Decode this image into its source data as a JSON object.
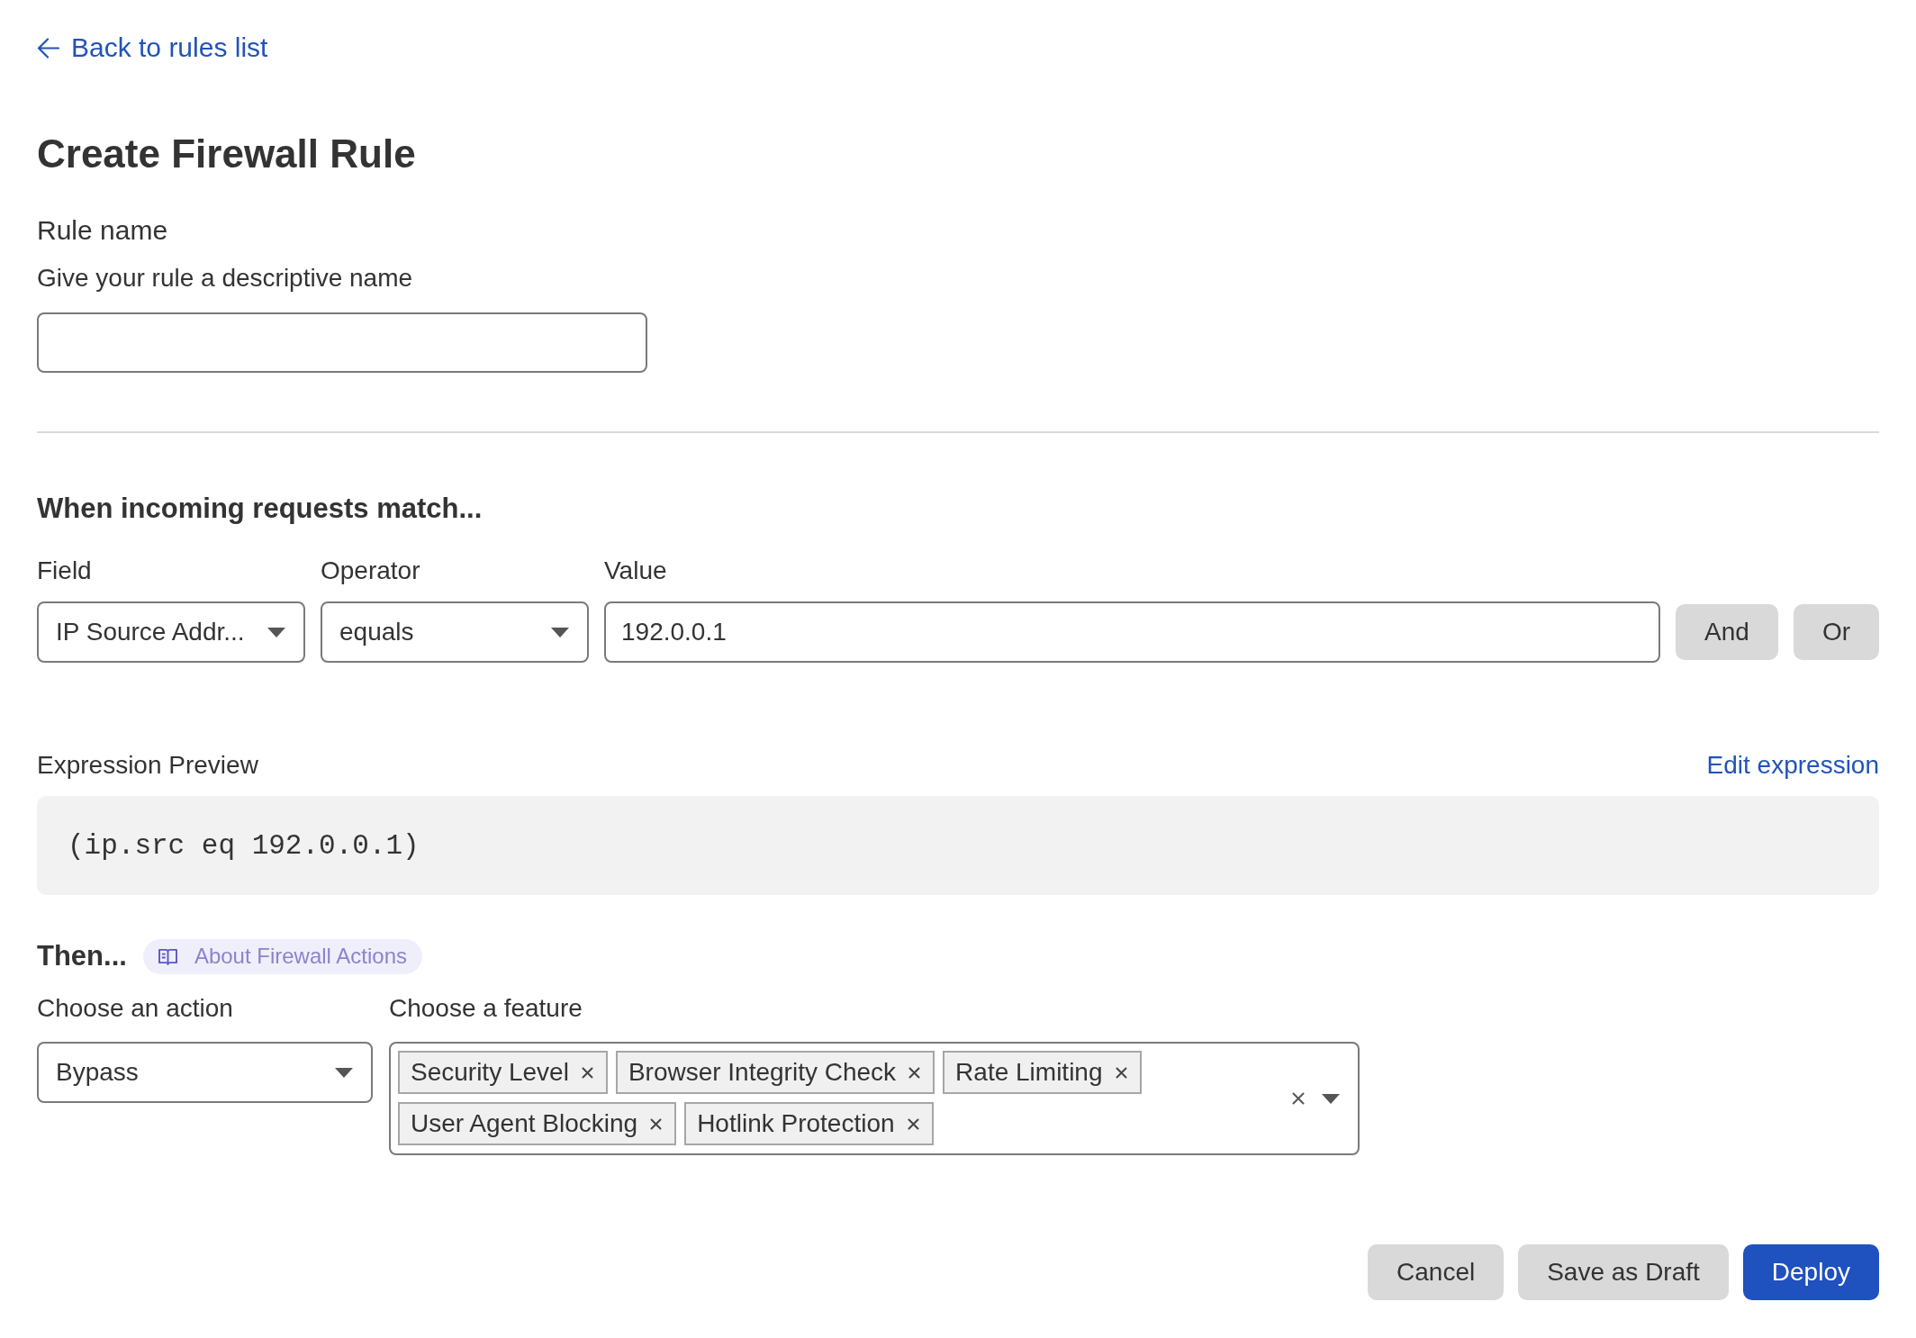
{
  "back_link": "Back to rules list",
  "title": "Create Firewall Rule",
  "rule_name": {
    "label": "Rule name",
    "hint": "Give your rule a descriptive name"
  },
  "match": {
    "heading": "When incoming requests match...",
    "field": {
      "label": "Field",
      "value": "IP Source Addr..."
    },
    "operator": {
      "label": "Operator",
      "value": "equals"
    },
    "value": {
      "label": "Value",
      "value": "192.0.0.1"
    },
    "logic_buttons": [
      "And",
      "Or"
    ]
  },
  "expression_preview": {
    "label": "Expression Preview",
    "edit_link": "Edit expression",
    "expression": "(ip.src eq 192.0.0.1)"
  },
  "then": {
    "heading": "Then...",
    "help_link": "About Firewall Actions",
    "action": {
      "label": "Choose an action",
      "value": "Bypass"
    },
    "feature": {
      "label": "Choose a feature",
      "tags": [
        "Security Level",
        "Browser Integrity Check",
        "Rate Limiting",
        "User Agent Blocking",
        "Hotlink Protection"
      ]
    }
  },
  "footer_buttons": [
    {
      "label": "Cancel",
      "kind": "secondary"
    },
    {
      "label": "Save as Draft",
      "kind": "secondary"
    },
    {
      "label": "Deploy",
      "kind": "primary"
    }
  ]
}
